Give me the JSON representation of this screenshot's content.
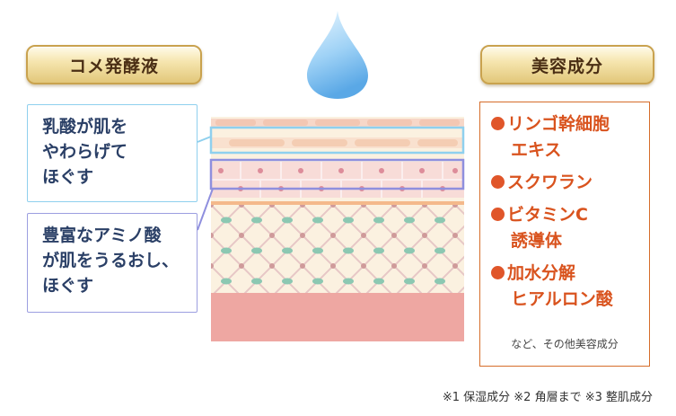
{
  "left_label": "コメ発酵液",
  "right_label": "美容成分",
  "callout_1": {
    "lines": [
      "乳酸が肌を",
      "やわらげて",
      "ほぐす"
    ]
  },
  "callout_2": {
    "lines": [
      "豊富なアミノ酸",
      "が肌をうるおし、",
      "ほぐす"
    ]
  },
  "ingredients": [
    {
      "lines": [
        "リンゴ幹細胞",
        "エキス"
      ]
    },
    {
      "lines": [
        "スクワラン"
      ]
    },
    {
      "lines": [
        "ビタミンC",
        "誘導体"
      ]
    },
    {
      "lines": [
        "加水分解",
        "ヒアルロン酸"
      ]
    }
  ],
  "other_note": "など、その他美容成分",
  "footnote": "※1 保湿成分 ※2 角層まで ※3 整肌成分",
  "colors": {
    "gold": "#e2c77a",
    "callout_blue": "#8fd0ee",
    "callout_purple": "#9c9ee0",
    "ingredient_orange": "#d9531e",
    "droplet": "#8fc7f0"
  },
  "icons": [
    "water-droplet-icon"
  ]
}
